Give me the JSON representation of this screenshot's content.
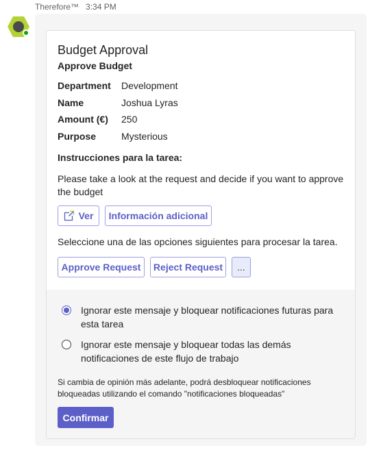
{
  "header": {
    "sender": "Therefore™",
    "time": "3:34 PM"
  },
  "card": {
    "title": "Budget Approval",
    "subtitle": "Approve Budget",
    "facts": [
      {
        "key": "Department",
        "value": "Development"
      },
      {
        "key": "Name",
        "value": "Joshua Lyras"
      },
      {
        "key": "Amount (€)",
        "value": "250"
      },
      {
        "key": "Purpose",
        "value": "Mysterious"
      }
    ],
    "instructions_heading": "Instrucciones para la tarea:",
    "instructions_body": "Please take a look at the request and decide if you want to approve the budget",
    "view_button": "Ver",
    "more_info_button": "Información adicional",
    "choose_text": "Seleccione una de las opciones siguientes para procesar la tarea.",
    "approve_button": "Approve Request",
    "reject_button": "Reject Request",
    "overflow_button": "...",
    "options": [
      {
        "label": "Ignorar este mensaje y bloquear notificaciones futuras para esta tarea",
        "checked": true
      },
      {
        "label": "Ignorar este mensaje y bloquear todas las demás notificaciones de este flujo de trabajo",
        "checked": false
      }
    ],
    "note": "Si cambia de opinión más adelante, podrá desbloquear notificaciones bloqueadas utilizando el comando \"notificaciones bloqueadas\"",
    "confirm_button": "Confirmar"
  },
  "colors": {
    "accent": "#5b5fc7",
    "bot_avatar": "#b3d334",
    "presence": "#13a10e"
  },
  "icons": {
    "avatar": "hexagon-bot-avatar",
    "presence": "available-status-icon",
    "view": "open-external-icon"
  }
}
